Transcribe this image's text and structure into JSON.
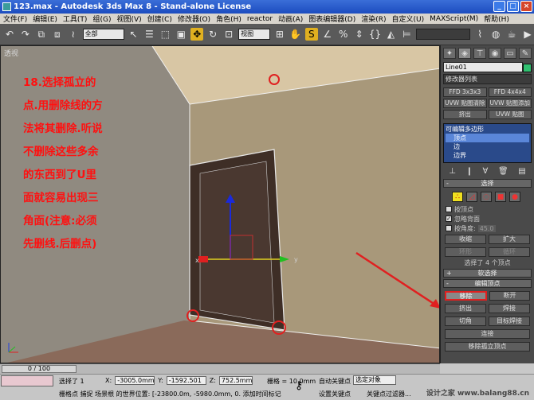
{
  "window": {
    "title": "123.max - Autodesk 3ds Max 8 - Stand-alone License"
  },
  "menu": [
    "文件(F)",
    "编辑(E)",
    "工具(T)",
    "组(G)",
    "视图(V)",
    "创建(C)",
    "修改器(O)",
    "角色(H)",
    "reactor",
    "动画(A)",
    "图表编辑器(D)",
    "渲染(R)",
    "自定义(U)",
    "MAXScript(M)",
    "帮助(H)"
  ],
  "toolbar": {
    "selection_filter": "全部",
    "ref_coord": "视图"
  },
  "viewport": {
    "label": "透视",
    "annotation": [
      "18.选择孤立的",
      "点.用删除线的方",
      "法将其删除.听说",
      "不删除这些多余",
      "的东西到了U里",
      "面就容易出现三",
      "角面(注意:必须",
      "先删线.后删点)"
    ],
    "gizmo": {
      "x_label": "x",
      "y_label": "y"
    }
  },
  "command_panel": {
    "object_name": "Line01",
    "modifier_list": "修改器列表",
    "buttons": [
      "FFD 3x3x3",
      "FFD 4x4x4",
      "UVW 贴图清除",
      "UVW 贴图添加",
      "挤出",
      "UVW 贴图"
    ],
    "stack": [
      {
        "label": "可编辑多边形",
        "level": 0,
        "selected": false
      },
      {
        "label": "顶点",
        "level": 1,
        "selected": true
      },
      {
        "label": "边",
        "level": 1,
        "selected": false
      },
      {
        "label": "边界",
        "level": 1,
        "selected": false
      }
    ],
    "selection_rollout": {
      "title": "选择",
      "by_vertex": "按顶点",
      "ignore_backfacing": "忽略背面",
      "by_angle": "按角度:",
      "angle_value": "45.0",
      "shrink": "收缩",
      "grow": "扩大",
      "ring": "环形",
      "loop": "循环",
      "info": "选择了 4 个顶点"
    },
    "soft_selection": "软选择",
    "edit_vertices": {
      "title": "编辑顶点",
      "remove": "移除",
      "break": "断开",
      "extrude": "挤出",
      "weld": "焊接",
      "chamfer": "切角",
      "target_weld": "目标焊接",
      "connect": "连接",
      "remove_isolated": "移除孤立顶点"
    }
  },
  "timeline": {
    "position": "0 / 100",
    "frame": 0,
    "total": 100
  },
  "status": {
    "selected": "选择了 1",
    "x_label": "X:",
    "x": "-3005.0mm",
    "y_label": "Y:",
    "y": "-1592.501",
    "z_label": "Z:",
    "z": "752.5mm",
    "grid": "栅格 = 10.0mm",
    "auto_key": "自动关键点",
    "selection_set": "选定对象",
    "prompt": "栅格点 捕捉 场景根 的世界位置: [-23800.0m, -5980.0mm, 0.",
    "add_time_tag": "添加时间标记",
    "set_key": "设置关键点",
    "key_filters": "关键点过滤器..."
  },
  "watermark": "设计之家 www.balang88.cn"
}
